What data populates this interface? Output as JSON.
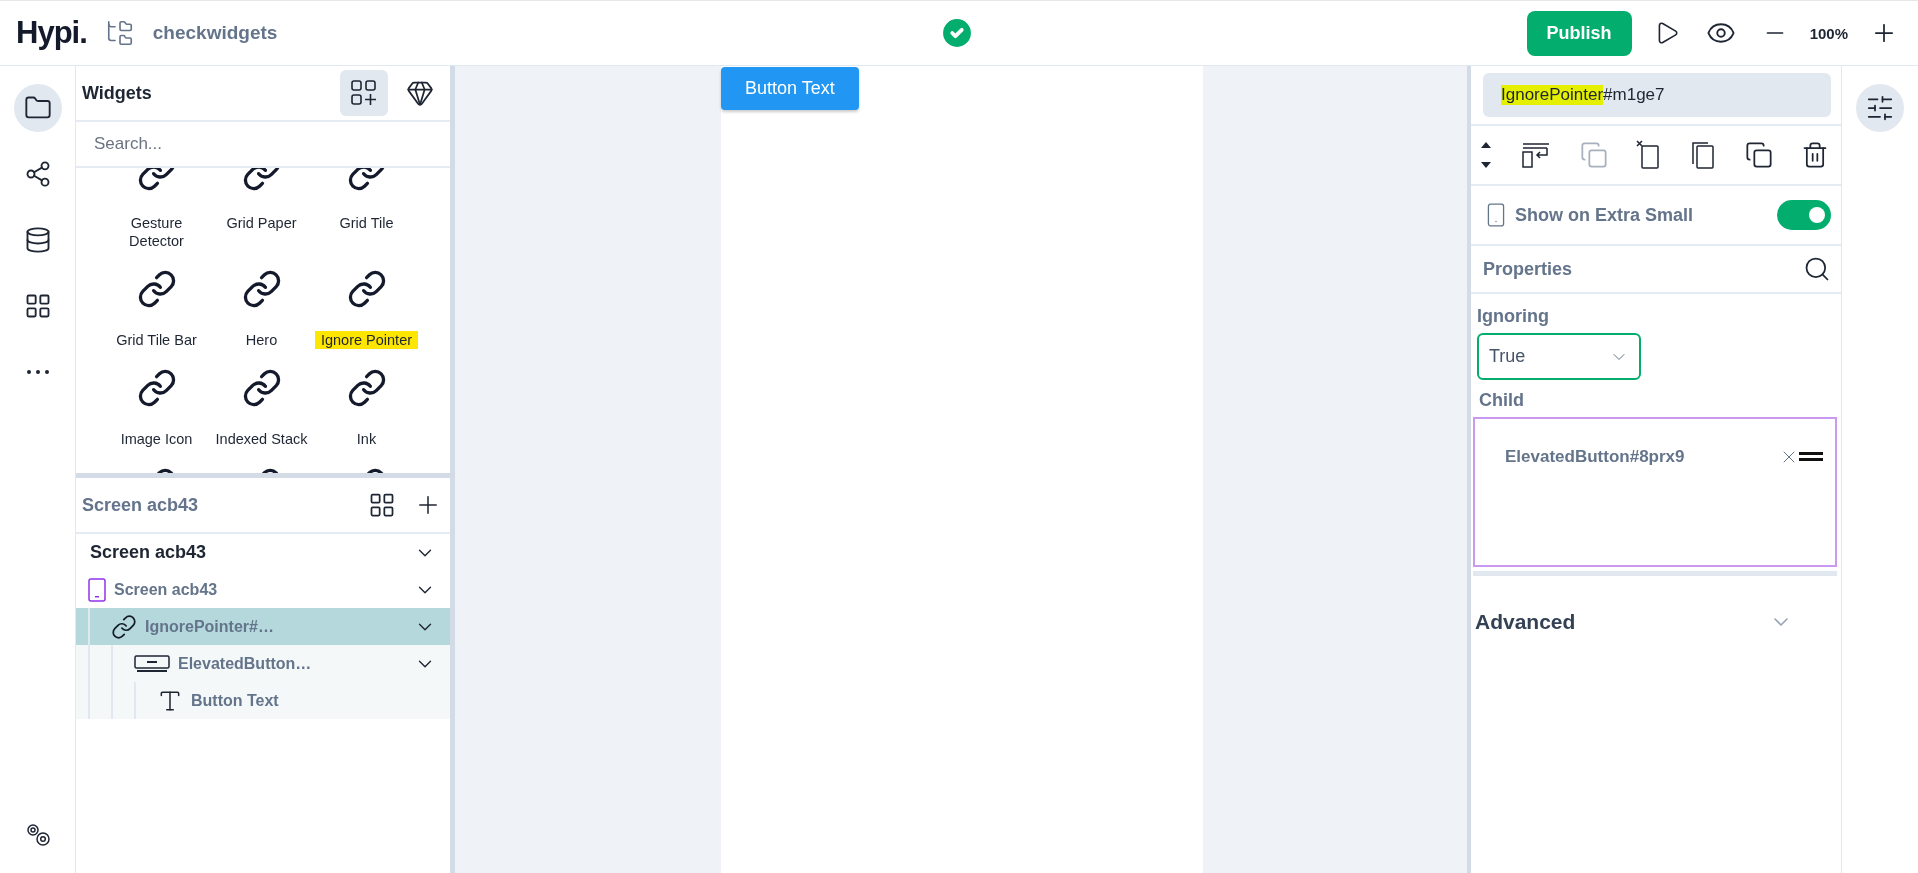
{
  "top_bar": {
    "logo": "Hypi.",
    "project": "checkwidgets",
    "saved": true,
    "publish": "Publish",
    "zoom": "100%"
  },
  "rail": [
    {
      "kind": "folder",
      "selected": true
    },
    {
      "kind": "graph",
      "selected": false
    },
    {
      "kind": "database",
      "selected": false
    },
    {
      "kind": "layout",
      "selected": false
    },
    {
      "kind": "more",
      "selected": false
    },
    {
      "kind": "settings",
      "selected": false
    }
  ],
  "widgets": {
    "title": "Widgets",
    "tabs": [
      {
        "kind": "widgets",
        "selected": true
      },
      {
        "kind": "gem",
        "selected": false
      }
    ],
    "search": {
      "placeholder": "Search..."
    },
    "items": [
      {
        "label": "Gesture Detector",
        "highlighted": false
      },
      {
        "label": "Grid Paper",
        "highlighted": false
      },
      {
        "label": "Grid Tile",
        "highlighted": false
      },
      {
        "label": "Grid Tile Bar",
        "highlighted": false
      },
      {
        "label": "Hero",
        "highlighted": false
      },
      {
        "label": "Ignore Pointer",
        "highlighted": true
      },
      {
        "label": "Image Icon",
        "highlighted": false
      },
      {
        "label": "Indexed Stack",
        "highlighted": false
      },
      {
        "label": "Ink",
        "highlighted": false
      }
    ]
  },
  "screen_panel": {
    "title": "Screen acb43",
    "tree": [
      {
        "label": "Screen acb43",
        "kind": "root",
        "selected": false,
        "expanded": true,
        "children": [
          {
            "label": "Screen acb43",
            "kind": "screen",
            "selected": false,
            "expanded": true,
            "children": [
              {
                "label": "IgnorePointer#…",
                "kind": "pointer",
                "selected": true,
                "expanded": true,
                "children": [
                  {
                    "label": "ElevatedButton…",
                    "kind": "button",
                    "selected": false,
                    "expanded": true,
                    "children": [
                      {
                        "label": "Button Text",
                        "kind": "text",
                        "selected": false
                      }
                    ]
                  }
                ]
              }
            ]
          }
        ]
      }
    ]
  },
  "canvas": {
    "button": "Button Text"
  },
  "inspector": {
    "name": [
      {
        "text": "IgnorePointer",
        "highlighted": true
      },
      {
        "text": "#m1ge7",
        "highlighted": false
      }
    ],
    "toolbar": [
      {
        "kind": "reorder",
        "disabled": false
      },
      {
        "kind": "wrap",
        "disabled": false
      },
      {
        "kind": "copy-style",
        "disabled": true
      },
      {
        "kind": "cut",
        "disabled": false
      },
      {
        "kind": "paste",
        "disabled": false
      },
      {
        "kind": "duplicate",
        "disabled": false
      },
      {
        "kind": "delete",
        "disabled": false
      }
    ],
    "visibility": {
      "label": "Show on Extra Small",
      "on": true
    },
    "properties_title": "Properties",
    "ignoring": {
      "label": "Ignoring",
      "value": "True"
    },
    "child": {
      "label": "Child",
      "item": "ElevatedButton#8prx9"
    },
    "advanced": {
      "label": "Advanced",
      "expanded": false
    }
  }
}
